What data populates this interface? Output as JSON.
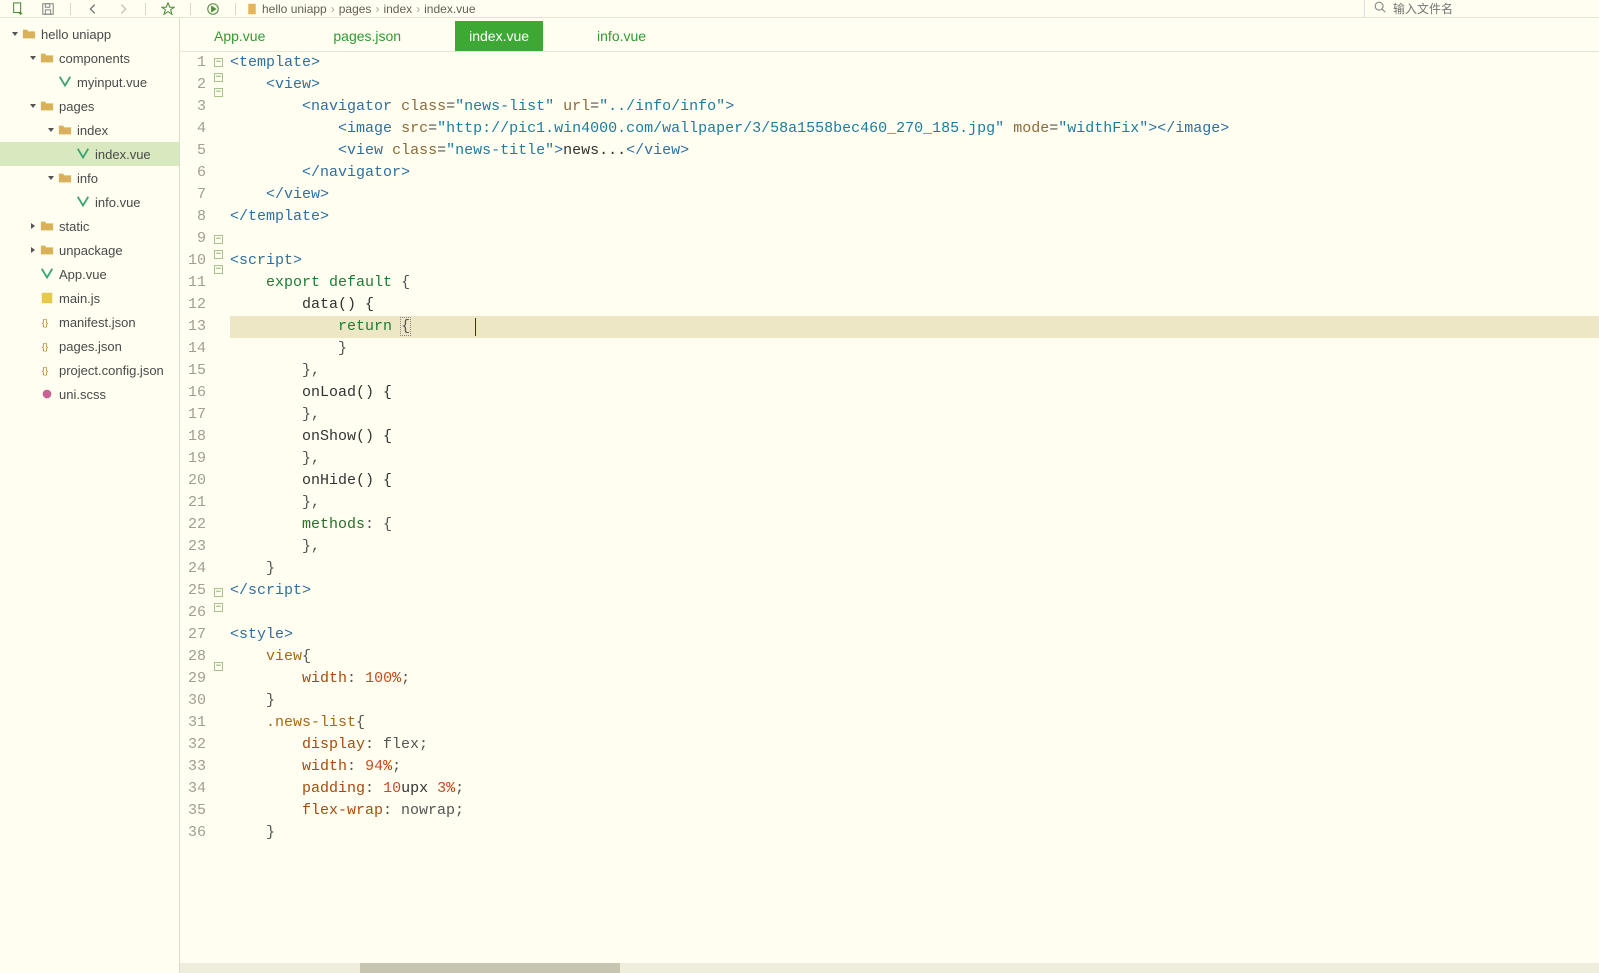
{
  "toolbar": {
    "breadcrumb": [
      "hello uniapp",
      "pages",
      "index",
      "index.vue"
    ],
    "search_placeholder": "输入文件名"
  },
  "fileTree": [
    {
      "indent": 0,
      "kind": "folder-open",
      "label": "hello uniapp",
      "arrow": "down"
    },
    {
      "indent": 1,
      "kind": "folder-open",
      "label": "components",
      "arrow": "down"
    },
    {
      "indent": 2,
      "kind": "file-vue",
      "label": "myinput.vue",
      "arrow": ""
    },
    {
      "indent": 1,
      "kind": "folder-open",
      "label": "pages",
      "arrow": "down"
    },
    {
      "indent": 2,
      "kind": "folder-open",
      "label": "index",
      "arrow": "down"
    },
    {
      "indent": 3,
      "kind": "file-vue",
      "label": "index.vue",
      "arrow": "",
      "selected": true
    },
    {
      "indent": 2,
      "kind": "folder-open",
      "label": "info",
      "arrow": "down"
    },
    {
      "indent": 3,
      "kind": "file-vue",
      "label": "info.vue",
      "arrow": ""
    },
    {
      "indent": 1,
      "kind": "folder",
      "label": "static",
      "arrow": "right"
    },
    {
      "indent": 1,
      "kind": "folder",
      "label": "unpackage",
      "arrow": "right"
    },
    {
      "indent": 1,
      "kind": "file-vue",
      "label": "App.vue",
      "arrow": ""
    },
    {
      "indent": 1,
      "kind": "file-js",
      "label": "main.js",
      "arrow": ""
    },
    {
      "indent": 1,
      "kind": "file-json",
      "label": "manifest.json",
      "arrow": ""
    },
    {
      "indent": 1,
      "kind": "file-json",
      "label": "pages.json",
      "arrow": ""
    },
    {
      "indent": 1,
      "kind": "file-json",
      "label": "project.config.json",
      "arrow": ""
    },
    {
      "indent": 1,
      "kind": "file-scss",
      "label": "uni.scss",
      "arrow": ""
    }
  ],
  "tabs": [
    {
      "label": "App.vue",
      "active": false
    },
    {
      "label": "pages.json",
      "active": false
    },
    {
      "label": "index.vue",
      "active": true
    },
    {
      "label": "info.vue",
      "active": false
    }
  ],
  "code": {
    "lines": [
      {
        "n": 1,
        "fold": "-",
        "tokens": [
          {
            "t": "<template>",
            "c": "tag"
          }
        ]
      },
      {
        "n": 2,
        "fold": "-",
        "tokens": [
          {
            "t": "    ",
            "c": "plain"
          },
          {
            "t": "<view>",
            "c": "tag"
          }
        ]
      },
      {
        "n": 3,
        "fold": "-",
        "tokens": [
          {
            "t": "        ",
            "c": "plain"
          },
          {
            "t": "<navigator ",
            "c": "tag"
          },
          {
            "t": "class",
            "c": "attr"
          },
          {
            "t": "=",
            "c": "punct"
          },
          {
            "t": "\"news-list\"",
            "c": "string"
          },
          {
            "t": " url",
            "c": "attr"
          },
          {
            "t": "=",
            "c": "punct"
          },
          {
            "t": "\"../info/info\"",
            "c": "string"
          },
          {
            "t": ">",
            "c": "tag"
          }
        ]
      },
      {
        "n": 4,
        "fold": "",
        "tokens": [
          {
            "t": "            ",
            "c": "plain"
          },
          {
            "t": "<image ",
            "c": "tag"
          },
          {
            "t": "src",
            "c": "attr"
          },
          {
            "t": "=",
            "c": "punct"
          },
          {
            "t": "\"http://pic1.win4000.com/wallpaper/3/58a1558bec460_270_185.jpg\"",
            "c": "string"
          },
          {
            "t": " mode",
            "c": "attr"
          },
          {
            "t": "=",
            "c": "punct"
          },
          {
            "t": "\"widthFix\"",
            "c": "string"
          },
          {
            "t": "></image>",
            "c": "tag"
          }
        ]
      },
      {
        "n": 5,
        "fold": "",
        "tokens": [
          {
            "t": "            ",
            "c": "plain"
          },
          {
            "t": "<view ",
            "c": "tag"
          },
          {
            "t": "class",
            "c": "attr"
          },
          {
            "t": "=",
            "c": "punct"
          },
          {
            "t": "\"news-title\"",
            "c": "string"
          },
          {
            "t": ">",
            "c": "tag"
          },
          {
            "t": "news...",
            "c": "plain"
          },
          {
            "t": "</view>",
            "c": "tag"
          }
        ]
      },
      {
        "n": 6,
        "fold": "",
        "tokens": [
          {
            "t": "        ",
            "c": "plain"
          },
          {
            "t": "</navigator>",
            "c": "tag"
          }
        ]
      },
      {
        "n": 7,
        "fold": "",
        "tokens": [
          {
            "t": "    ",
            "c": "plain"
          },
          {
            "t": "</view>",
            "c": "tag"
          }
        ]
      },
      {
        "n": 8,
        "fold": "",
        "tokens": [
          {
            "t": "</template>",
            "c": "tag"
          }
        ]
      },
      {
        "n": 9,
        "fold": "",
        "tokens": [
          {
            "t": "",
            "c": "plain"
          }
        ]
      },
      {
        "n": 10,
        "fold": "-",
        "tokens": [
          {
            "t": "<script>",
            "c": "tag"
          }
        ]
      },
      {
        "n": 11,
        "fold": "-",
        "tokens": [
          {
            "t": "    ",
            "c": "plain"
          },
          {
            "t": "export ",
            "c": "kw"
          },
          {
            "t": "default ",
            "c": "kw"
          },
          {
            "t": "{",
            "c": "punct"
          }
        ]
      },
      {
        "n": 12,
        "fold": "-",
        "tokens": [
          {
            "t": "        ",
            "c": "plain"
          },
          {
            "t": "data() {",
            "c": "plain"
          }
        ]
      },
      {
        "n": 13,
        "fold": "",
        "hl": true,
        "tokens": [
          {
            "t": "            ",
            "c": "plain"
          },
          {
            "t": "return ",
            "c": "kw"
          },
          {
            "t": "{",
            "c": "punct",
            "bm": true
          }
        ],
        "cursor": true
      },
      {
        "n": 14,
        "fold": "",
        "tokens": [
          {
            "t": "            ",
            "c": "plain"
          },
          {
            "t": "}",
            "c": "punct",
            "bm": true
          }
        ]
      },
      {
        "n": 15,
        "fold": "",
        "tokens": [
          {
            "t": "        ",
            "c": "plain"
          },
          {
            "t": "},",
            "c": "punct"
          }
        ]
      },
      {
        "n": 16,
        "fold": "",
        "tokens": [
          {
            "t": "        ",
            "c": "plain"
          },
          {
            "t": "onLoad() {",
            "c": "plain"
          }
        ]
      },
      {
        "n": 17,
        "fold": "",
        "tokens": [
          {
            "t": "        ",
            "c": "plain"
          },
          {
            "t": "},",
            "c": "punct"
          }
        ]
      },
      {
        "n": 18,
        "fold": "",
        "tokens": [
          {
            "t": "        ",
            "c": "plain"
          },
          {
            "t": "onShow() {",
            "c": "plain"
          }
        ]
      },
      {
        "n": 19,
        "fold": "",
        "tokens": [
          {
            "t": "        ",
            "c": "plain"
          },
          {
            "t": "},",
            "c": "punct"
          }
        ]
      },
      {
        "n": 20,
        "fold": "",
        "tokens": [
          {
            "t": "        ",
            "c": "plain"
          },
          {
            "t": "onHide() {",
            "c": "plain"
          }
        ]
      },
      {
        "n": 21,
        "fold": "",
        "tokens": [
          {
            "t": "        ",
            "c": "plain"
          },
          {
            "t": "},",
            "c": "punct"
          }
        ]
      },
      {
        "n": 22,
        "fold": "",
        "tokens": [
          {
            "t": "        ",
            "c": "plain"
          },
          {
            "t": "methods",
            "c": "method"
          },
          {
            "t": ": {",
            "c": "punct"
          }
        ]
      },
      {
        "n": 23,
        "fold": "",
        "tokens": [
          {
            "t": "        ",
            "c": "plain"
          },
          {
            "t": "},",
            "c": "punct"
          }
        ]
      },
      {
        "n": 24,
        "fold": "",
        "tokens": [
          {
            "t": "    ",
            "c": "plain"
          },
          {
            "t": "}",
            "c": "punct"
          }
        ]
      },
      {
        "n": 25,
        "fold": "",
        "tokens": [
          {
            "t": "</script>",
            "c": "tag"
          }
        ]
      },
      {
        "n": 26,
        "fold": "",
        "tokens": [
          {
            "t": "",
            "c": "plain"
          }
        ]
      },
      {
        "n": 27,
        "fold": "-",
        "tokens": [
          {
            "t": "<style>",
            "c": "tag"
          }
        ]
      },
      {
        "n": 28,
        "fold": "-",
        "tokens": [
          {
            "t": "    ",
            "c": "plain"
          },
          {
            "t": "view",
            "c": "sel"
          },
          {
            "t": "{",
            "c": "punct"
          }
        ]
      },
      {
        "n": 29,
        "fold": "",
        "tokens": [
          {
            "t": "        ",
            "c": "plain"
          },
          {
            "t": "width",
            "c": "prop"
          },
          {
            "t": ": ",
            "c": "punct"
          },
          {
            "t": "100",
            "c": "num"
          },
          {
            "t": "%",
            "c": "important"
          },
          {
            "t": ";",
            "c": "punct"
          }
        ]
      },
      {
        "n": 30,
        "fold": "",
        "tokens": [
          {
            "t": "    ",
            "c": "plain"
          },
          {
            "t": "}",
            "c": "punct"
          }
        ]
      },
      {
        "n": 31,
        "fold": "-",
        "tokens": [
          {
            "t": "    ",
            "c": "plain"
          },
          {
            "t": ".news-list",
            "c": "sel"
          },
          {
            "t": "{",
            "c": "punct"
          }
        ]
      },
      {
        "n": 32,
        "fold": "",
        "tokens": [
          {
            "t": "        ",
            "c": "plain"
          },
          {
            "t": "display",
            "c": "prop"
          },
          {
            "t": ": flex;",
            "c": "punct"
          }
        ]
      },
      {
        "n": 33,
        "fold": "",
        "tokens": [
          {
            "t": "        ",
            "c": "plain"
          },
          {
            "t": "width",
            "c": "prop"
          },
          {
            "t": ": ",
            "c": "punct"
          },
          {
            "t": "94",
            "c": "num"
          },
          {
            "t": "%",
            "c": "important"
          },
          {
            "t": ";",
            "c": "punct"
          }
        ]
      },
      {
        "n": 34,
        "fold": "",
        "tokens": [
          {
            "t": "        ",
            "c": "plain"
          },
          {
            "t": "padding",
            "c": "prop"
          },
          {
            "t": ": ",
            "c": "punct"
          },
          {
            "t": "10",
            "c": "num"
          },
          {
            "t": "upx ",
            "c": "plain"
          },
          {
            "t": "3",
            "c": "num"
          },
          {
            "t": "%",
            "c": "important"
          },
          {
            "t": ";",
            "c": "punct"
          }
        ]
      },
      {
        "n": 35,
        "fold": "",
        "tokens": [
          {
            "t": "        ",
            "c": "plain"
          },
          {
            "t": "flex-wrap",
            "c": "prop"
          },
          {
            "t": ": nowrap;",
            "c": "punct"
          }
        ]
      },
      {
        "n": 36,
        "fold": "",
        "tokens": [
          {
            "t": "    ",
            "c": "plain"
          },
          {
            "t": "}",
            "c": "punct"
          }
        ]
      }
    ]
  }
}
